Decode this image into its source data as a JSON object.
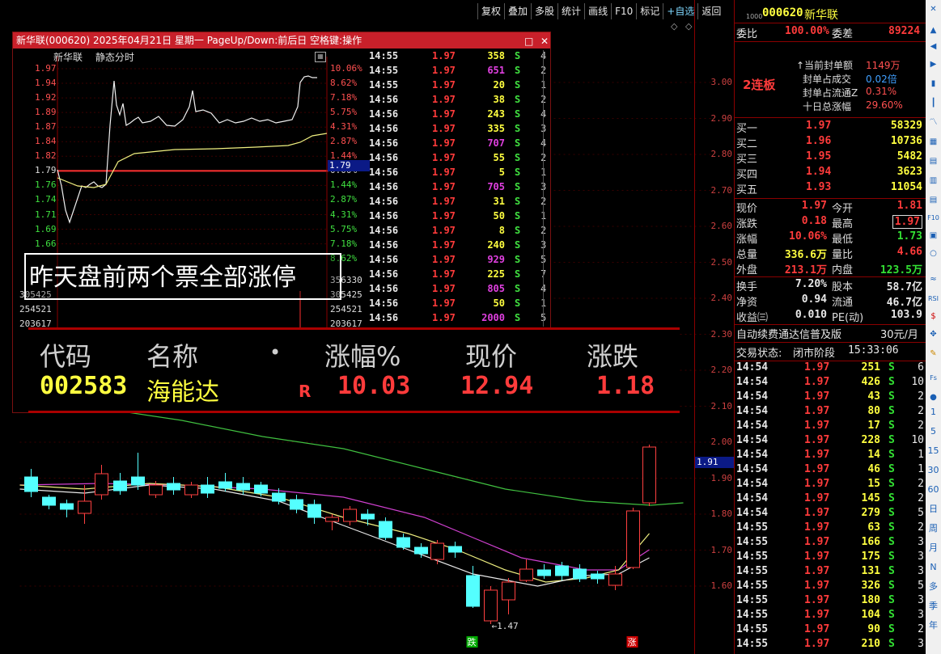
{
  "toolbar": {
    "items": [
      "复权",
      "叠加",
      "多股",
      "统计",
      "画线",
      "F10",
      "标记",
      "+自选",
      "返回"
    ]
  },
  "kline": {
    "y_axis": [
      "3.00",
      "2.90",
      "2.80",
      "2.70",
      "2.60",
      "2.50",
      "2.40",
      "2.30",
      "2.20",
      "2.10",
      "2.00",
      "1.90",
      "1.80",
      "1.70",
      "1.60"
    ],
    "current_price_tag": "1.91",
    "low_marker": "1.47",
    "bottom_left_tag": "跌",
    "bottom_right_tag": "涨"
  },
  "popup": {
    "title": "新华联(000620) 2025年04月21日 星期一 PageUp/Down:前后日 空格键:操作",
    "stock_name": "新华联",
    "mode": "静态分时",
    "prices_left": [
      "1.97",
      "1.94",
      "1.92",
      "1.89",
      "1.87",
      "1.84",
      "1.82",
      "1.79",
      "1.76",
      "1.74",
      "1.71",
      "1.69",
      "1.66"
    ],
    "pct_right": [
      "10.06%",
      "8.62%",
      "7.18%",
      "5.75%",
      "4.31%",
      "2.87%",
      "1.44%",
      "0.00%",
      "1.44%",
      "2.87%",
      "4.31%",
      "5.75%",
      "7.18%",
      "8.62%"
    ],
    "current_tag": "1.79",
    "volume_left": [
      "305425",
      "254521",
      "203617"
    ],
    "volume_right": [
      "356330",
      "305425",
      "254521",
      "203617"
    ],
    "ticks": [
      [
        "14:55",
        "1.97",
        "358",
        "S",
        "4"
      ],
      [
        "14:55",
        "1.97",
        "651",
        "S",
        "2"
      ],
      [
        "14:55",
        "1.97",
        "20",
        "S",
        "1"
      ],
      [
        "14:56",
        "1.97",
        "38",
        "S",
        "2"
      ],
      [
        "14:56",
        "1.97",
        "243",
        "S",
        "4"
      ],
      [
        "14:56",
        "1.97",
        "335",
        "S",
        "3"
      ],
      [
        "14:56",
        "1.97",
        "707",
        "S",
        "4"
      ],
      [
        "14:56",
        "1.97",
        "55",
        "S",
        "2"
      ],
      [
        "14:56",
        "1.97",
        "5",
        "S",
        "1"
      ],
      [
        "14:56",
        "1.97",
        "705",
        "S",
        "3"
      ],
      [
        "14:56",
        "1.97",
        "31",
        "S",
        "2"
      ],
      [
        "14:56",
        "1.97",
        "50",
        "S",
        "1"
      ],
      [
        "14:56",
        "1.97",
        "8",
        "S",
        "2"
      ],
      [
        "14:56",
        "1.97",
        "240",
        "S",
        "3"
      ],
      [
        "14:56",
        "1.97",
        "929",
        "S",
        "5"
      ],
      [
        "14:56",
        "1.97",
        "225",
        "S",
        "7"
      ],
      [
        "14:56",
        "1.97",
        "805",
        "S",
        "4"
      ],
      [
        "14:56",
        "1.97",
        "50",
        "S",
        "1"
      ],
      [
        "14:56",
        "1.97",
        "2000",
        "S",
        "5"
      ]
    ]
  },
  "caption": "昨天盘前两个票全部涨停",
  "stockbar": {
    "headers": [
      "代码",
      "名称",
      "•",
      "涨幅%",
      "现价",
      "涨跌"
    ],
    "code": "002583",
    "name": "海能达",
    "flag": "R",
    "pct": "10.03",
    "price": "12.94",
    "change": "1.18"
  },
  "right_panel": {
    "code": "000620",
    "name": "新华联",
    "webi_label": "委比",
    "webi_value": "100.00%",
    "weicha_label": "委差",
    "weicha_value": "89224",
    "streak": "2连板",
    "seal_info": [
      [
        "当前封单额",
        "1149万"
      ],
      [
        "封单占成交",
        "0.02倍"
      ],
      [
        "封单占流通Z",
        "0.31%"
      ],
      [
        "十日总涨幅",
        "29.60%"
      ]
    ],
    "bids": [
      [
        "买一",
        "1.97",
        "58329"
      ],
      [
        "买二",
        "1.96",
        "10736"
      ],
      [
        "买三",
        "1.95",
        "5482"
      ],
      [
        "买四",
        "1.94",
        "3623"
      ],
      [
        "买五",
        "1.93",
        "11054"
      ]
    ],
    "quote": [
      [
        "现价",
        "1.97",
        "今开",
        "1.81"
      ],
      [
        "涨跌",
        "0.18",
        "最高",
        "1.97"
      ],
      [
        "涨幅",
        "10.06%",
        "最低",
        "1.73"
      ],
      [
        "总量",
        "336.6万",
        "量比",
        "4.66"
      ],
      [
        "外盘",
        "213.1万",
        "内盘",
        "123.5万"
      ]
    ],
    "fundamentals": [
      [
        "换手",
        "7.20%",
        "股本",
        "58.7亿"
      ],
      [
        "净资",
        "0.94",
        "流通",
        "46.7亿"
      ],
      [
        "收益㈢",
        "0.010",
        "PE(动)",
        "103.9"
      ]
    ],
    "ad_text": "自动续费通达信普及版",
    "ad_price": "30元/月",
    "status_label": "交易状态:",
    "status_value": "闭市阶段",
    "status_time": "15:33:06",
    "ticks": [
      [
        "14:54",
        "1.97",
        "251",
        "S",
        "6"
      ],
      [
        "14:54",
        "1.97",
        "426",
        "S",
        "10"
      ],
      [
        "14:54",
        "1.97",
        "43",
        "S",
        "2"
      ],
      [
        "14:54",
        "1.97",
        "80",
        "S",
        "2"
      ],
      [
        "14:54",
        "1.97",
        "17",
        "S",
        "2"
      ],
      [
        "14:54",
        "1.97",
        "228",
        "S",
        "10"
      ],
      [
        "14:54",
        "1.97",
        "14",
        "S",
        "1"
      ],
      [
        "14:54",
        "1.97",
        "46",
        "S",
        "1"
      ],
      [
        "14:54",
        "1.97",
        "15",
        "S",
        "2"
      ],
      [
        "14:54",
        "1.97",
        "145",
        "S",
        "2"
      ],
      [
        "14:54",
        "1.97",
        "279",
        "S",
        "5"
      ],
      [
        "14:55",
        "1.97",
        "63",
        "S",
        "2"
      ],
      [
        "14:55",
        "1.97",
        "166",
        "S",
        "3"
      ],
      [
        "14:55",
        "1.97",
        "175",
        "S",
        "3"
      ],
      [
        "14:55",
        "1.97",
        "131",
        "S",
        "3"
      ],
      [
        "14:55",
        "1.97",
        "326",
        "S",
        "5"
      ],
      [
        "14:55",
        "1.97",
        "180",
        "S",
        "3"
      ],
      [
        "14:55",
        "1.97",
        "104",
        "S",
        "3"
      ],
      [
        "14:55",
        "1.97",
        "90",
        "S",
        "2"
      ],
      [
        "14:55",
        "1.97",
        "210",
        "S",
        "3"
      ]
    ]
  },
  "sidebar": {
    "items": [
      "1",
      "5",
      "15",
      "30",
      "60",
      "日",
      "周",
      "月",
      "N",
      "多",
      "季",
      "年"
    ]
  }
}
